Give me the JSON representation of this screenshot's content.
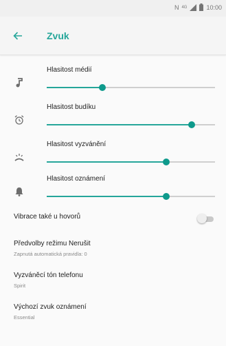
{
  "status_bar": {
    "network_label": "N ",
    "signal_label": "4G",
    "time": "10:00"
  },
  "header": {
    "back_icon": "arrow-back-icon",
    "title": "Zvuk"
  },
  "colors": {
    "accent": "#26a69a",
    "thumb": "#0e9a8c",
    "track": "#cfcfcf"
  },
  "volume_sliders": [
    {
      "label": "Hlasitost médií",
      "icon": "music-note-icon",
      "level": 0.33
    },
    {
      "label": "Hlasitost budíku",
      "icon": "alarm-clock-icon",
      "level": 0.86
    },
    {
      "label": "Hlasitost vyzvánění",
      "icon": "ringer-icon",
      "level": 0.71
    },
    {
      "label": "Hlasitost oznámení",
      "icon": "bell-icon",
      "level": 0.71
    }
  ],
  "vibrate": {
    "label": "Vibrace také u hovorů",
    "enabled": false
  },
  "preferences": [
    {
      "title": "Předvolby režimu Nerušit",
      "summary": "Zapnutá automatická pravidla: 0"
    },
    {
      "title": "Vyzváněcí tón telefonu",
      "summary": "Spirit"
    },
    {
      "title": "Výchozí zvuk oznámení",
      "summary": "Essential"
    }
  ]
}
